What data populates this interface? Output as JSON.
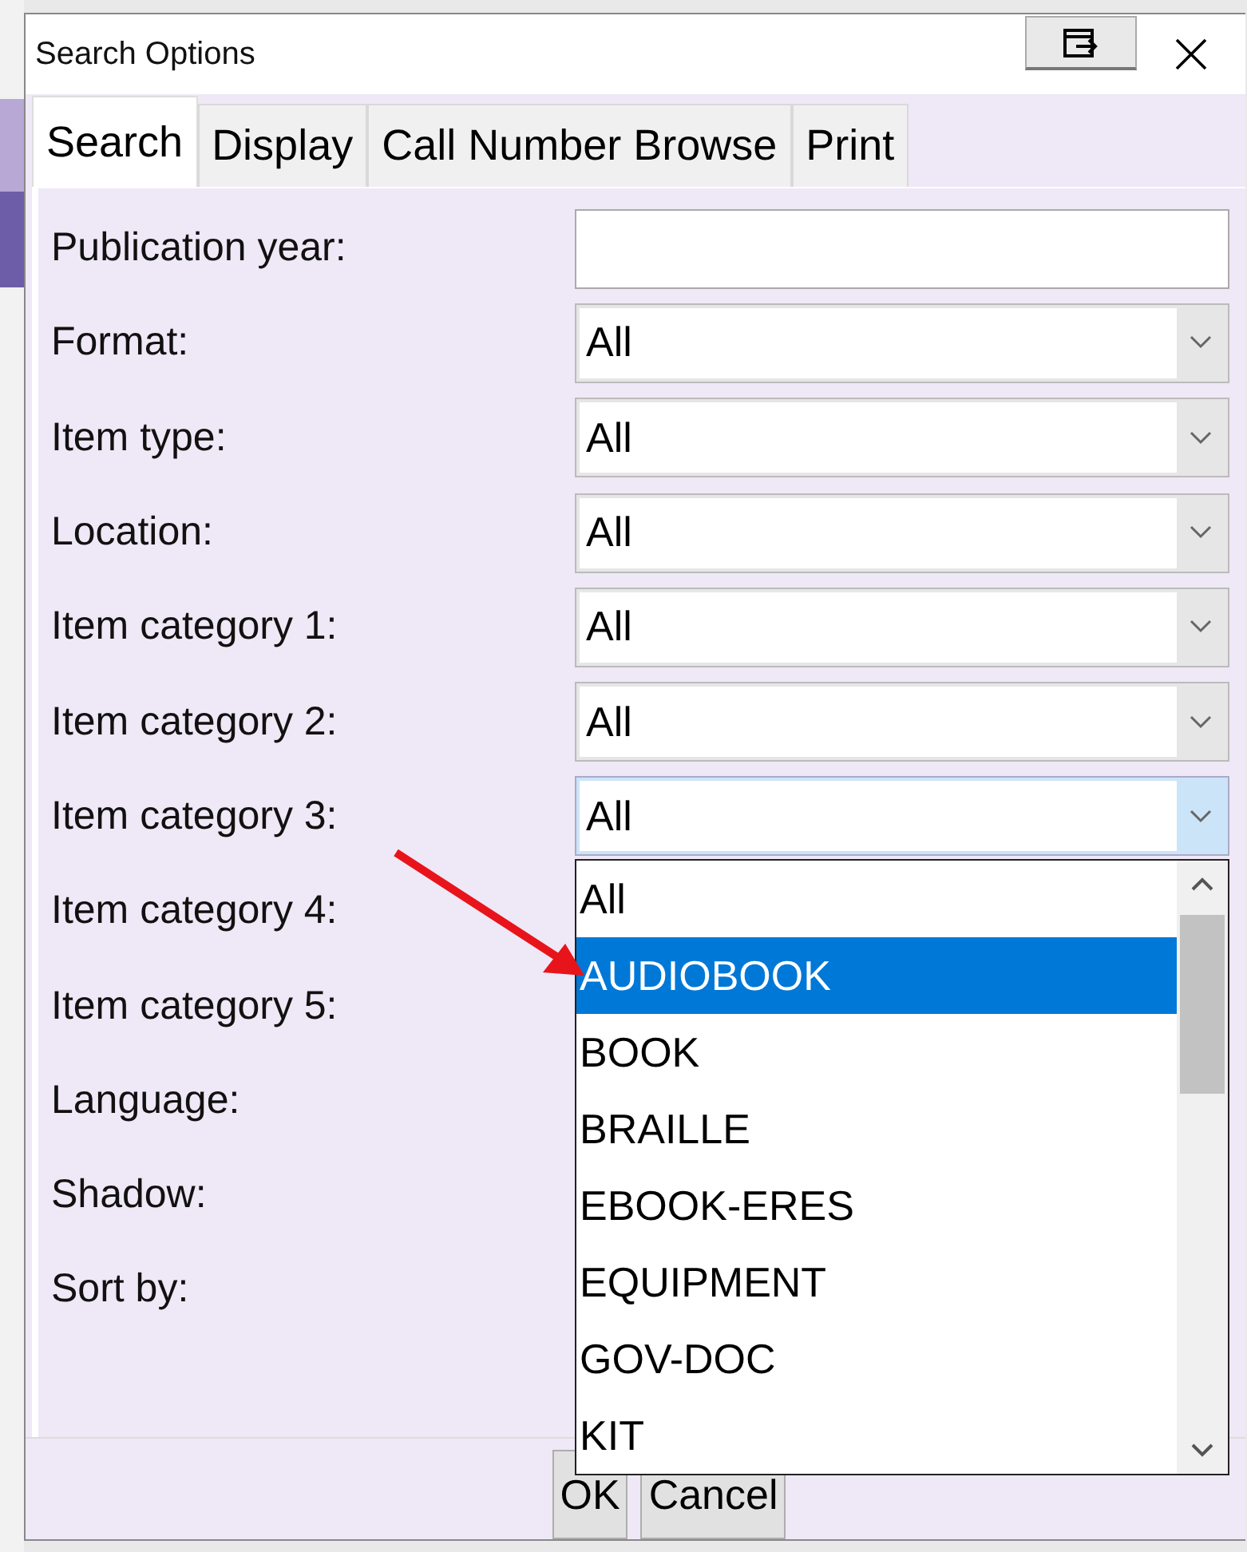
{
  "window": {
    "title": "Search Options"
  },
  "tabs": [
    {
      "label": "Search",
      "selected": true
    },
    {
      "label": "Display",
      "selected": false
    },
    {
      "label": "Call Number Browse",
      "selected": false
    },
    {
      "label": "Print",
      "selected": false
    }
  ],
  "fields": [
    {
      "label": "Publication year:",
      "kind": "text"
    },
    {
      "label": "Format:",
      "kind": "select",
      "value": "All",
      "expanded": false
    },
    {
      "label": "Item type:",
      "kind": "select",
      "value": "All",
      "expanded": false
    },
    {
      "label": "Location:",
      "kind": "select",
      "value": "All",
      "expanded": false
    },
    {
      "label": "Item category 1:",
      "kind": "select",
      "value": "All",
      "expanded": false
    },
    {
      "label": "Item category 2:",
      "kind": "select",
      "value": "All",
      "expanded": false
    },
    {
      "label": "Item category 3:",
      "kind": "select",
      "value": "All",
      "expanded": true
    },
    {
      "label": "Item category 4:",
      "kind": "hidden"
    },
    {
      "label": "Item category 5:",
      "kind": "hidden"
    },
    {
      "label": "Language:",
      "kind": "hidden"
    },
    {
      "label": "Shadow:",
      "kind": "hidden"
    },
    {
      "label": "Sort by:",
      "kind": "hidden"
    }
  ],
  "dropdown_options": [
    {
      "label": "All",
      "selected": false
    },
    {
      "label": "AUDIOBOOK",
      "selected": true
    },
    {
      "label": "BOOK",
      "selected": false
    },
    {
      "label": "BRAILLE",
      "selected": false
    },
    {
      "label": "EBOOK-ERES",
      "selected": false
    },
    {
      "label": "EQUIPMENT",
      "selected": false
    },
    {
      "label": "GOV-DOC",
      "selected": false
    },
    {
      "label": "KIT",
      "selected": false
    }
  ],
  "buttons": [
    "OK",
    "Cancel"
  ]
}
